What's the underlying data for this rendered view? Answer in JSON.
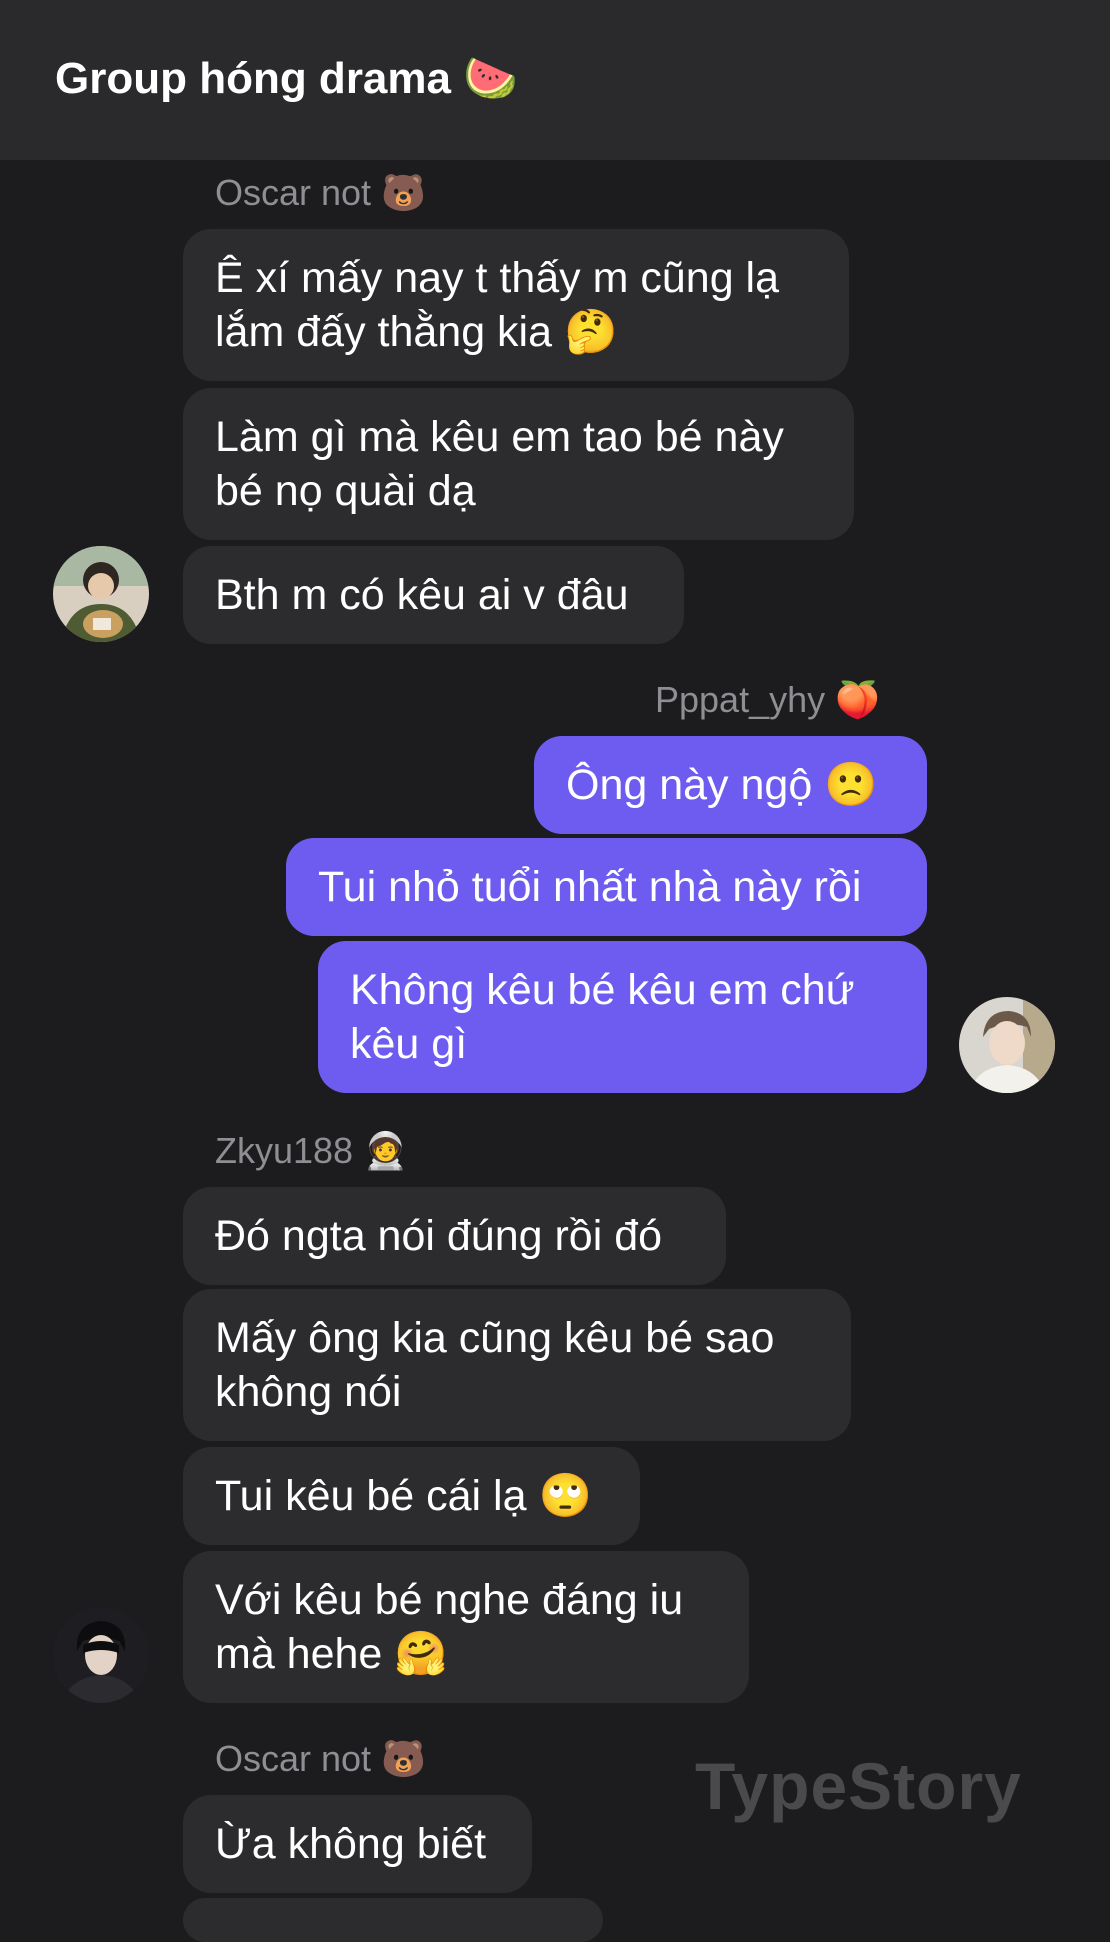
{
  "header": {
    "title": "Group hóng drama 🍉"
  },
  "groups": [
    {
      "sender": "Oscar not 🐻",
      "messages": [
        "Ê xí mấy nay t thấy m cũng lạ lắm đấy thằng kia 🤔",
        "Làm gì mà kêu em tao bé này bé nọ quài dạ",
        "Bth m có kêu ai v đâu"
      ]
    },
    {
      "sender": "Pppat_yhy 🍑",
      "messages": [
        "Ông này ngộ 🙁",
        "Tui nhỏ tuổi nhất nhà này rồi",
        "Không kêu bé kêu em chứ kêu gì"
      ]
    },
    {
      "sender": "Zkyu188 🧑‍🚀",
      "messages": [
        "Đó ngta nói đúng rồi đó",
        "Mấy ông kia cũng kêu bé sao không nói",
        "Tui kêu bé cái lạ 🙄",
        "Với kêu bé nghe đáng iu mà hehe 🤗"
      ]
    },
    {
      "sender": "Oscar not 🐻",
      "messages": [
        "Ừa không biết"
      ]
    }
  ],
  "watermark": "TypeStory"
}
